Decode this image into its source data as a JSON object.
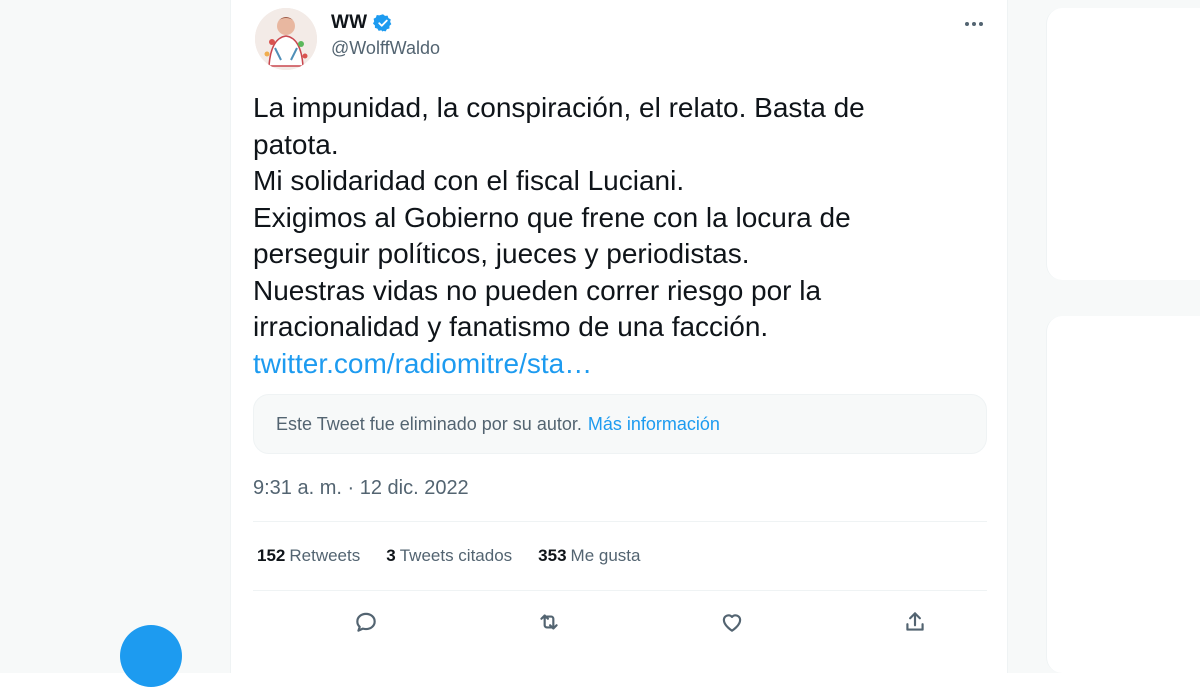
{
  "colors": {
    "accent": "#1d9bf0",
    "text_primary": "#0f1419",
    "text_secondary": "#536471"
  },
  "author": {
    "name": "WW",
    "handle": "@WolffWaldo",
    "verified": true,
    "verified_icon": "verified-badge-icon",
    "avatar_icon": "avatar-illustration"
  },
  "tweet": {
    "text_lines": [
      "La impunidad, la conspiración,  el relato. Basta de",
      "patota.",
      "Mi solidaridad con el fiscal Luciani.",
      "Exigimos al Gobierno que frene con la locura de",
      "perseguir políticos, jueces y periodistas.",
      "Nuestras vidas no pueden correr riesgo por la",
      "irracionalidad y fanatismo de una facción."
    ],
    "link": "twitter.com/radiomitre/sta…",
    "quoted_notice": "Este Tweet fue eliminado por su autor.",
    "quoted_more_info": "Más información",
    "timestamp": "9:31 a. m. · 12 dic. 2022"
  },
  "stats": {
    "retweets_count": "152",
    "retweets_label": "Retweets",
    "quotes_count": "3",
    "quotes_label": "Tweets citados",
    "likes_count": "353",
    "likes_label": "Me gusta"
  },
  "actions": [
    "reply-icon",
    "retweet-icon",
    "like-icon",
    "share-icon"
  ]
}
